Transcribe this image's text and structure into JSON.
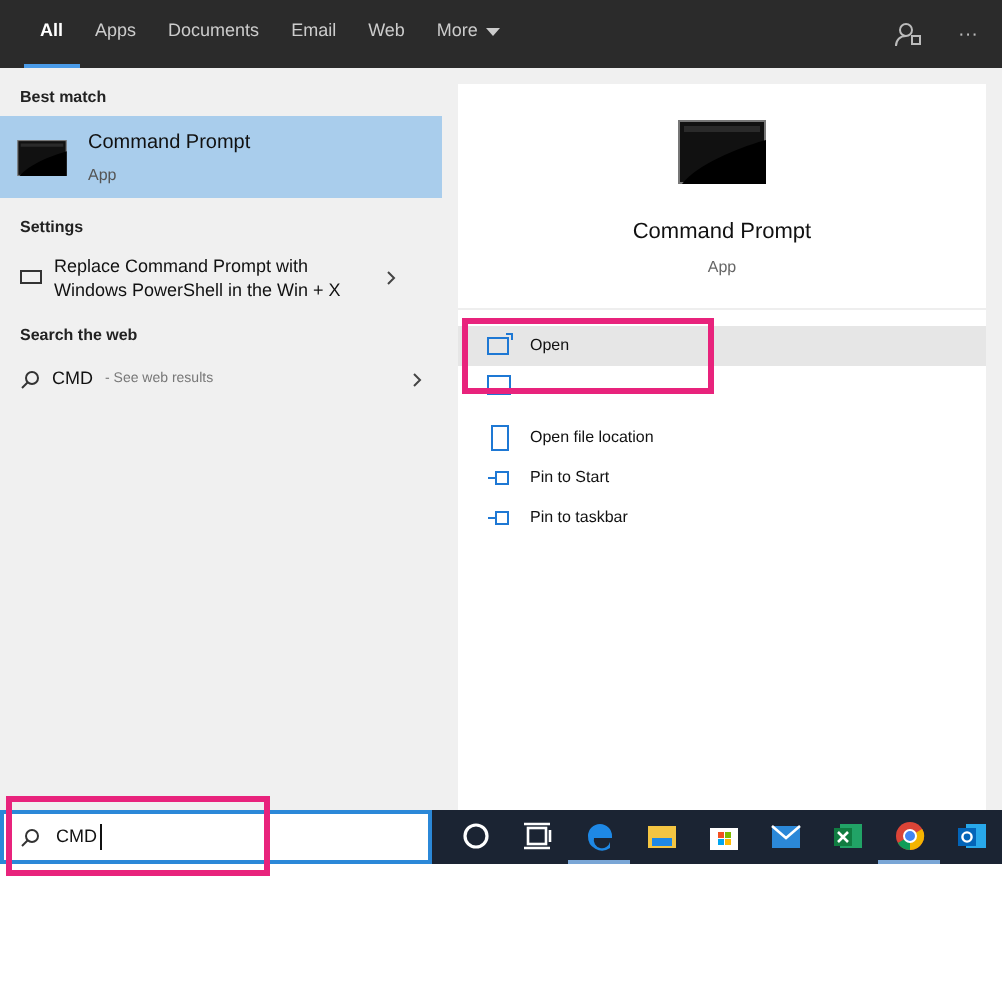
{
  "tabs": [
    {
      "label": "All",
      "selected": true
    },
    {
      "label": "Apps",
      "selected": false
    },
    {
      "label": "Documents",
      "selected": false
    },
    {
      "label": "Email",
      "selected": false
    },
    {
      "label": "Web",
      "selected": false
    },
    {
      "label": "More",
      "selected": false,
      "dropdown": true
    }
  ],
  "toolbar": {
    "more": "···"
  },
  "results": {
    "sections": [
      {
        "header": "Best match",
        "items": [
          {
            "kind": "app",
            "title": "Command Prompt",
            "subtitle": "App",
            "selected": true
          }
        ]
      },
      {
        "header": "Settings",
        "items": [
          {
            "kind": "setting",
            "title": "Replace Command Prompt with Windows PowerShell in the Win + X",
            "selected": false
          }
        ]
      },
      {
        "header": "Search the web",
        "items": [
          {
            "kind": "web",
            "title": "CMD",
            "subtitle": "- See web results",
            "selected": false
          }
        ]
      }
    ]
  },
  "preview": {
    "title": "Command Prompt",
    "subtitle": "App",
    "actions": [
      {
        "kind": "open",
        "label": "Open",
        "selected": true,
        "highlighted": true
      },
      {
        "kind": "admin",
        "selected": false,
        "highlighted": true
      },
      {
        "kind": "folder",
        "label": "Open file location",
        "selected": false,
        "highlighted": false
      },
      {
        "kind": "pin",
        "label": "Pin to Start",
        "selected": false,
        "highlighted": false
      },
      {
        "kind": "pin",
        "label": "Pin to taskbar",
        "selected": false,
        "highlighted": false
      }
    ]
  },
  "search": {
    "value": "CMD",
    "highlighted": true
  },
  "taskbar": [
    {
      "kind": "cortana",
      "running": false
    },
    {
      "kind": "taskview",
      "running": false
    },
    {
      "kind": "edge",
      "running": true
    },
    {
      "kind": "explorer",
      "running": false
    },
    {
      "kind": "store",
      "running": false
    },
    {
      "kind": "mail",
      "running": false
    },
    {
      "kind": "excel",
      "running": false
    },
    {
      "kind": "chrome",
      "running": true
    },
    {
      "kind": "outlook",
      "running": false
    }
  ]
}
